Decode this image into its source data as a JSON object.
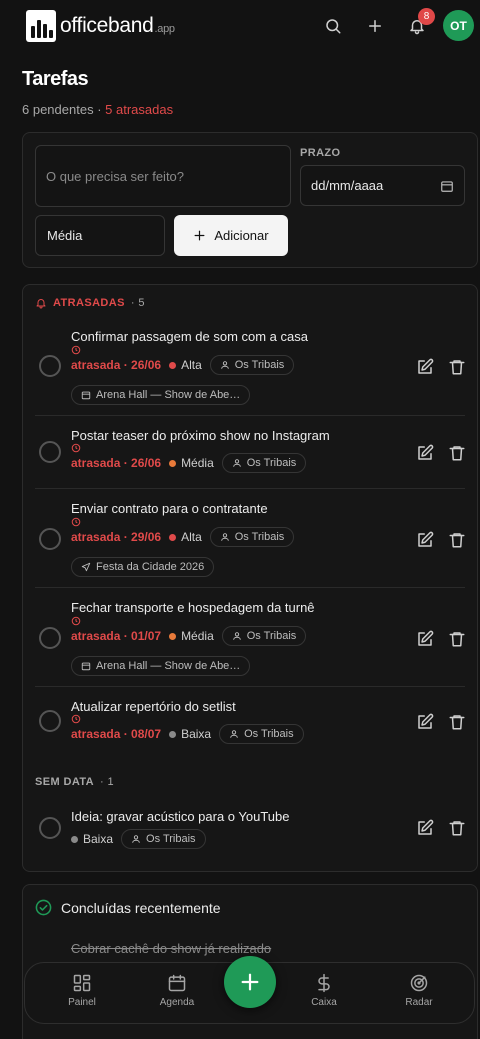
{
  "app": {
    "brand": "officeband",
    "brand_suffix": ".app",
    "notification_count": "8",
    "avatar_initials": "OT"
  },
  "page": {
    "title": "Tarefas",
    "pending_text": "6 pendentes",
    "separator": " · ",
    "late_text": "5 atrasadas"
  },
  "form": {
    "task_placeholder": "O que precisa ser feito?",
    "deadline_label": "PRAZO",
    "date_placeholder": "dd/mm/aaaa",
    "priority_value": "Média",
    "add_label": "Adicionar"
  },
  "sections": {
    "late_label": "ATRASADAS",
    "late_count": "· 5",
    "nodate_label": "SEM DATA",
    "nodate_count": "· 1"
  },
  "colors": {
    "alta": "#e04a4a",
    "media": "#e87a3a",
    "baixa": "#8a8a8a",
    "accent": "#1f9a57"
  },
  "late_tasks": [
    {
      "title": "Confirmar passagem de som com a casa",
      "due": "atrasada · 26/06",
      "priority": "Alta",
      "priority_color": "#e04a4a",
      "assignee": "Os Tribais",
      "event": "Arena Hall — Show de Abe…",
      "event_icon": "calendar-icon"
    },
    {
      "title": "Postar teaser do próximo show no Instagram",
      "due": "atrasada · 26/06",
      "priority": "Média",
      "priority_color": "#e87a3a",
      "assignee": "Os Tribais"
    },
    {
      "title": "Enviar contrato para o contratante",
      "due": "atrasada · 29/06",
      "priority": "Alta",
      "priority_color": "#e04a4a",
      "assignee": "Os Tribais",
      "event": "Festa da Cidade 2026",
      "event_icon": "send-icon"
    },
    {
      "title": "Fechar transporte e hospedagem da turnê",
      "due": "atrasada · 01/07",
      "priority": "Média",
      "priority_color": "#e87a3a",
      "assignee": "Os Tribais",
      "event": "Arena Hall — Show de Abe…",
      "event_icon": "calendar-icon"
    },
    {
      "title": "Atualizar repertório do setlist",
      "due": "atrasada · 08/07",
      "priority": "Baixa",
      "priority_color": "#8a8a8a",
      "assignee": "Os Tribais"
    }
  ],
  "nodate_tasks": [
    {
      "title": "Ideia: gravar acústico para o YouTube",
      "priority": "Baixa",
      "priority_color": "#8a8a8a",
      "assignee": "Os Tribais"
    }
  ],
  "done": {
    "title": "Concluídas recentemente",
    "items": [
      "Cobrar cachê do show já realizado"
    ]
  },
  "nav": {
    "items": [
      {
        "label": "Painel",
        "icon": "dashboard-icon"
      },
      {
        "label": "Agenda",
        "icon": "calendar-icon"
      },
      {
        "label": "Caixa",
        "icon": "dollar-icon"
      },
      {
        "label": "Radar",
        "icon": "radar-icon"
      }
    ]
  }
}
